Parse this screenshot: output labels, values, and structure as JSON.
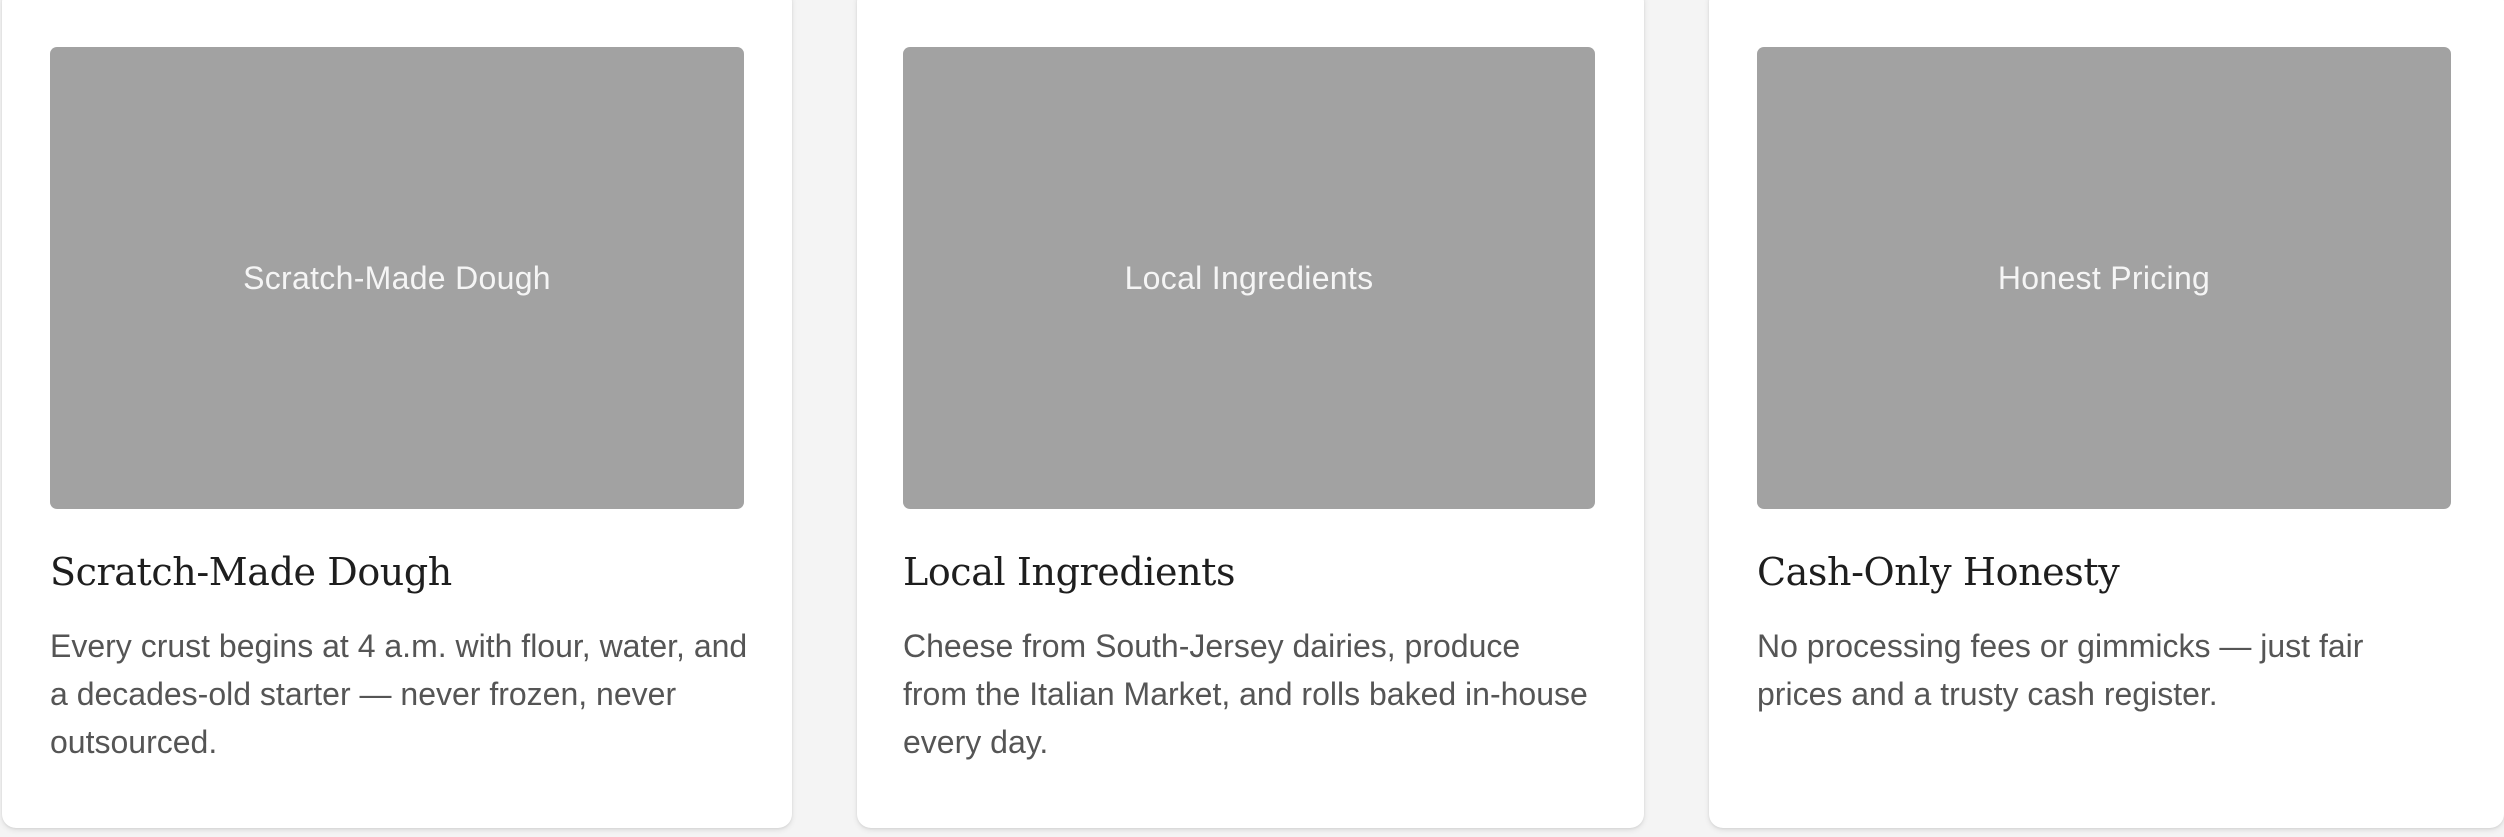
{
  "features": [
    {
      "image_label": "Scratch-Made Dough",
      "title": "Scratch-Made Dough",
      "description": "Every crust begins at 4 a.m. with flour, water, and a decades-old starter — never frozen, never outsourced."
    },
    {
      "image_label": "Local Ingredients",
      "title": "Local Ingredients",
      "description": "Cheese from South-Jersey dairies, produce from the Italian Market, and rolls baked in-house every day."
    },
    {
      "image_label": "Honest Pricing",
      "title": "Cash-Only Honesty",
      "description": "No processing fees or gimmicks — just fair prices and a trusty cash register."
    }
  ],
  "colors": {
    "card_background": "#ffffff",
    "image_placeholder": "#a2a2a2",
    "title_text": "#1e1e1e",
    "body_text": "#555555"
  }
}
